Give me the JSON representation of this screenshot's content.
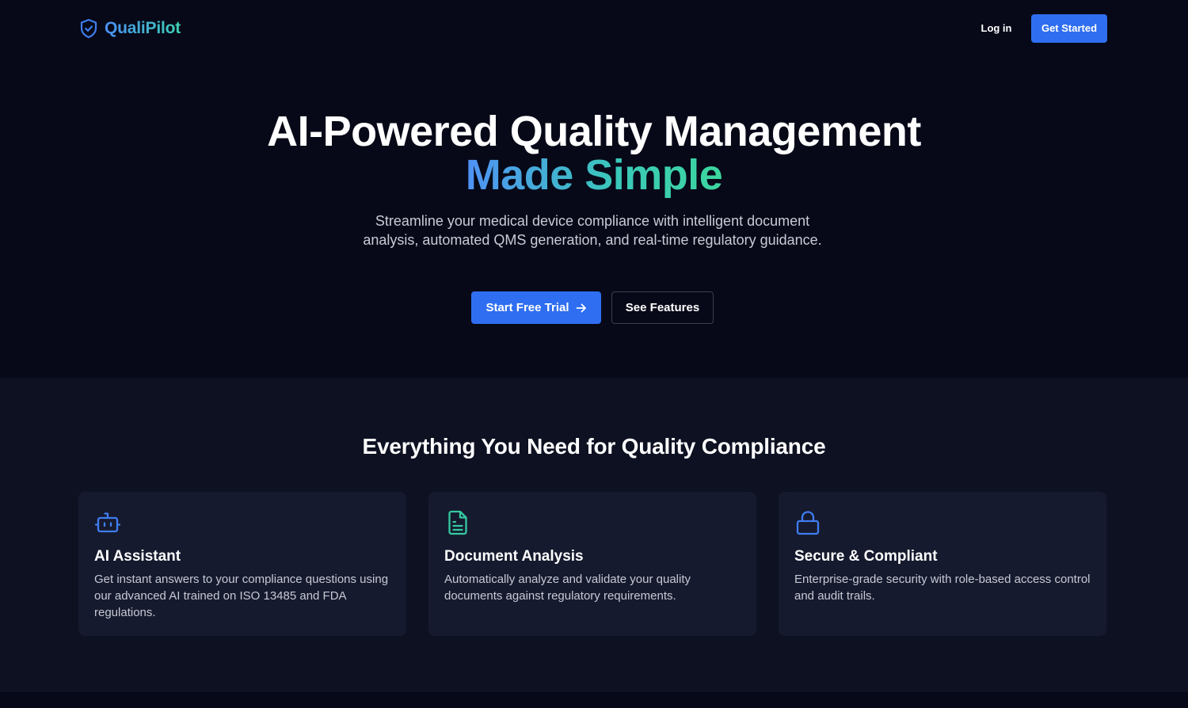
{
  "header": {
    "brand_name": "QualiPilot",
    "brand_icon": "shield-check-icon",
    "login_label": "Log in",
    "get_started_label": "Get Started"
  },
  "hero": {
    "title_line1": "AI-Powered Quality Management",
    "title_line2": "Made Simple",
    "subtitle": "Streamline your medical device compliance with intelligent document analysis, automated QMS generation, and real-time regulatory guidance.",
    "primary_cta": "Start Free Trial",
    "primary_cta_icon": "arrow-right-icon",
    "secondary_cta": "See Features"
  },
  "features": {
    "title": "Everything You Need for Quality Compliance",
    "cards": [
      {
        "icon": "bot-icon",
        "title": "AI Assistant",
        "description": "Get instant answers to your compliance questions using our advanced AI trained on ISO 13485 and FDA regulations."
      },
      {
        "icon": "document-icon",
        "title": "Document Analysis",
        "description": "Automatically analyze and validate your quality documents against regulatory requirements."
      },
      {
        "icon": "lock-icon",
        "title": "Secure & Compliant",
        "description": "Enterprise-grade security with role-based access control and audit trails."
      }
    ]
  },
  "colors": {
    "background": "#070918",
    "section_background": "#0e1122",
    "card_background": "#161a2e",
    "primary_blue": "#2f6ef0",
    "gradient_start": "#4f92f6",
    "gradient_end": "#3dd69f"
  }
}
